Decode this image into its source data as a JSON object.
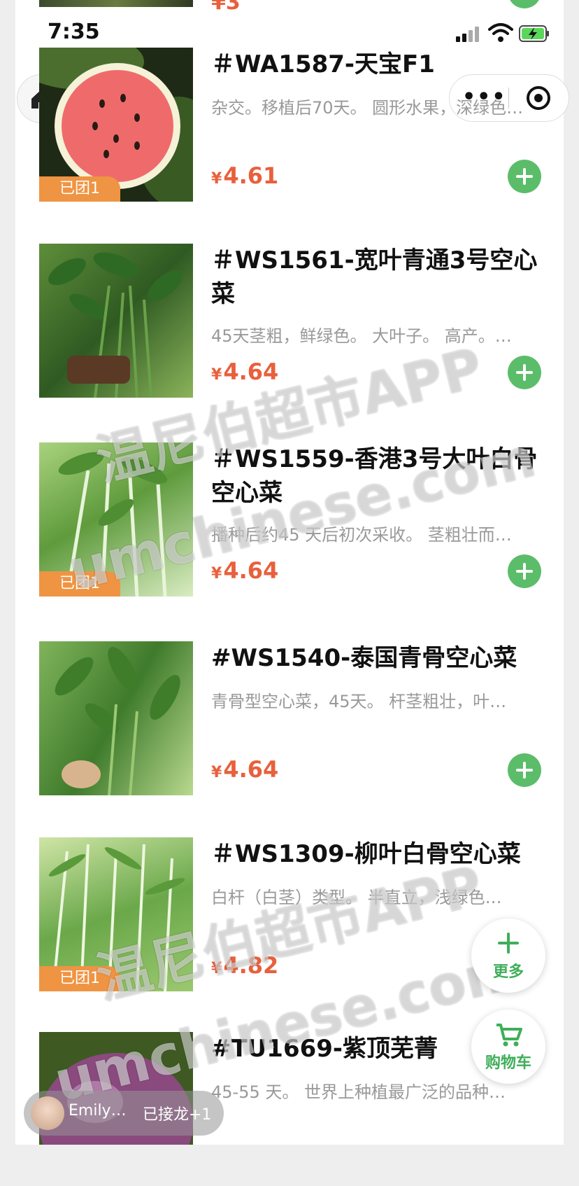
{
  "status_bar": {
    "time": "7:35"
  },
  "colors": {
    "accent_green": "#5bbd6a",
    "price_red": "#e8603c",
    "badge_orange": "#ef9442"
  },
  "nav": {
    "home_icon": "home-icon",
    "more_icon": "more-dots-icon",
    "close_icon": "target-circle-icon"
  },
  "partial_top": {
    "price": "¥3"
  },
  "products": [
    {
      "title": "＃WA1587-天宝F1",
      "desc": "杂交。移植后70天。 圆形水果，深绿色…",
      "price": "4.61",
      "badge": "已团1"
    },
    {
      "title": "＃WS1561-宽叶青通3号空心菜",
      "desc": "45天茎粗，鲜绿色。 大叶子。 高产。…",
      "price": "4.64",
      "badge": ""
    },
    {
      "title": "＃WS1559-香港3号大叶白骨空心菜",
      "desc": "播种后约45 天后初次采收。 茎粗壮而…",
      "price": "4.64",
      "badge": "已团1"
    },
    {
      "title": "#WS1540-泰国青骨空心菜",
      "desc": "青骨型空心菜，45天。 杆茎粗壮，叶…",
      "price": "4.64",
      "badge": ""
    },
    {
      "title": "＃WS1309-柳叶白骨空心菜",
      "desc": "白杆（白茎）类型。 半直立，浅绿色…",
      "price": "4.82",
      "badge": "已团1"
    },
    {
      "title": "#TU1669-紫顶芜菁",
      "desc": "45-55 天。 世界上种植最广泛的品种…",
      "price": "",
      "badge": ""
    }
  ],
  "currency": "¥",
  "fab": {
    "more_label": "更多",
    "cart_label": "购物车"
  },
  "activity": {
    "name": "Emily…",
    "status": "已接龙+1"
  },
  "watermark": {
    "line1": "温尼伯超市APP",
    "line2": "umchinese.com"
  }
}
